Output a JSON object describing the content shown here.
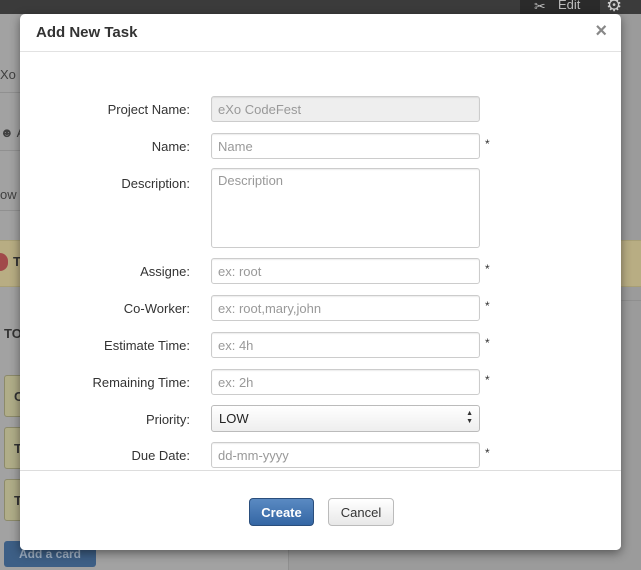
{
  "background": {
    "edit_label": "Edit",
    "left_snippets": [
      "Xo",
      "A",
      "ow t",
      "T",
      "TO",
      "C",
      "T",
      "T"
    ],
    "add_card_label": "Add a card"
  },
  "modal": {
    "title": "Add New Task",
    "close_symbol": "×",
    "required_mark": "*",
    "fields": {
      "project_name": {
        "label": "Project Name:",
        "value": "eXo CodeFest"
      },
      "name": {
        "label": "Name:",
        "placeholder": "Name"
      },
      "description": {
        "label": "Description:",
        "placeholder": "Description"
      },
      "assignee": {
        "label": "Assigne:",
        "placeholder": "ex: root"
      },
      "coworker": {
        "label": "Co-Worker:",
        "placeholder": "ex: root,mary,john"
      },
      "estimate_time": {
        "label": "Estimate Time:",
        "placeholder": "ex: 4h"
      },
      "remaining_time": {
        "label": "Remaining Time:",
        "placeholder": "ex: 2h"
      },
      "priority": {
        "label": "Priority:",
        "selected": "LOW"
      },
      "due_date": {
        "label": "Due Date:",
        "placeholder": "dd-mm-yyyy"
      }
    },
    "buttons": {
      "create": "Create",
      "cancel": "Cancel"
    }
  },
  "colors": {
    "primary_button": "#3466a4",
    "overlay_bg": "#9b9b9b"
  }
}
